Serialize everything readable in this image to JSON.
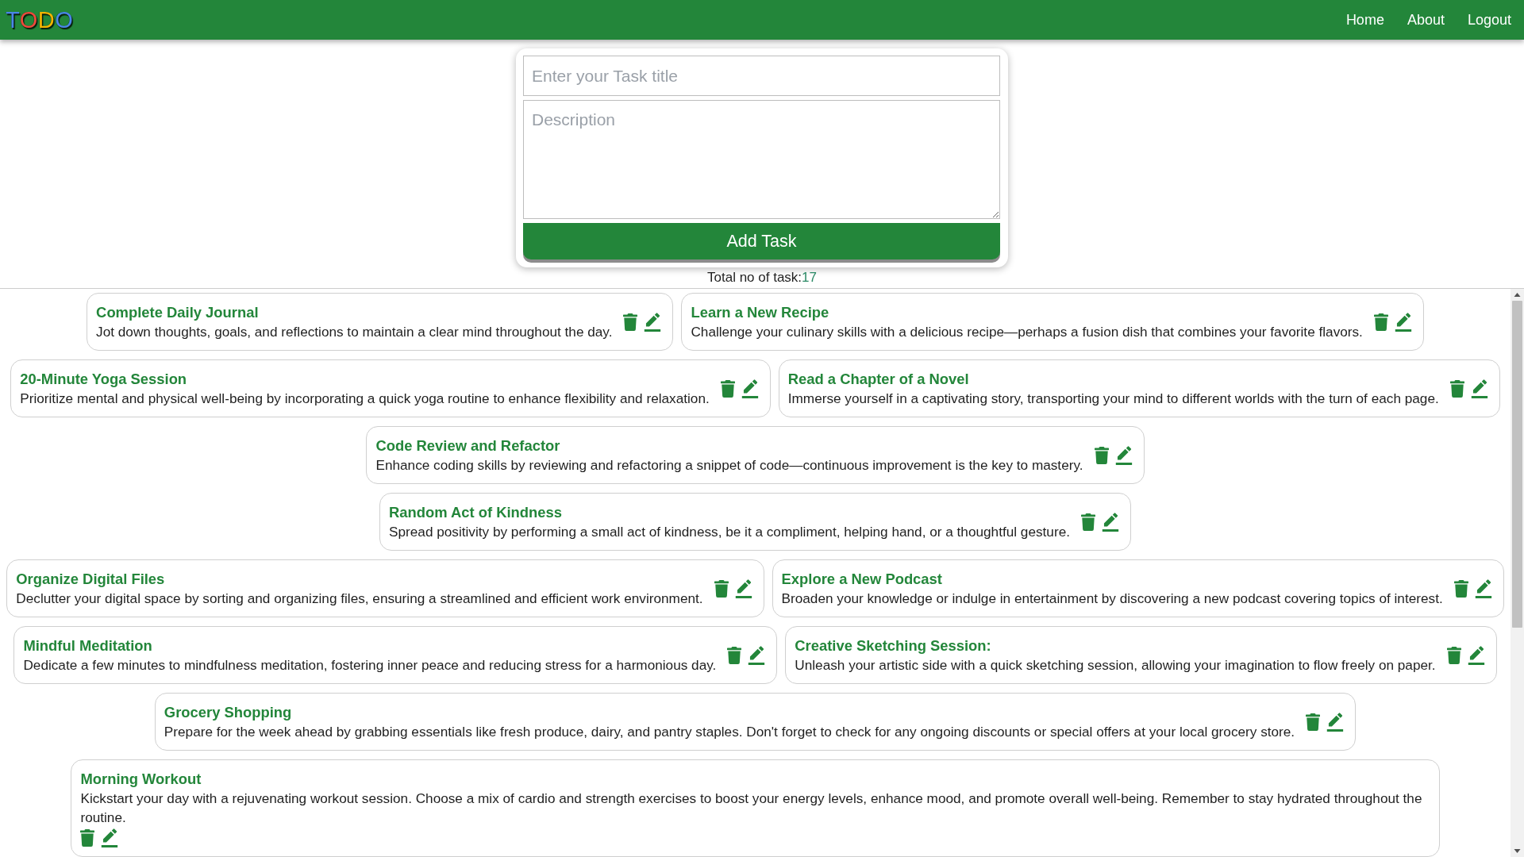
{
  "header": {
    "logo": [
      {
        "text": "T",
        "color": "#4a86e8"
      },
      {
        "text": "O",
        "color": "#ef4a3c"
      },
      {
        "text": "D",
        "color": "#f4b400"
      },
      {
        "text": "O",
        "color": "#4a86e8"
      }
    ],
    "nav": [
      "Home",
      "About",
      "Logout"
    ]
  },
  "form": {
    "title_field": {
      "placeholder": "Enter your Task title"
    },
    "description_field": {
      "placeholder": "Description"
    },
    "submit_button": "Add Task"
  },
  "total": {
    "label": "Total no of task:",
    "count": "17"
  },
  "tasks": [
    {
      "title": "Complete Daily Journal",
      "description": "Jot down thoughts, goals, and reflections to maintain a clear mind throughout the day."
    },
    {
      "title": "Learn a New Recipe",
      "description": "Challenge your culinary skills with a delicious recipe—perhaps a fusion dish that combines your favorite flavors."
    },
    {
      "title": "20-Minute Yoga Session",
      "description": "Prioritize mental and physical well-being by incorporating a quick yoga routine to enhance flexibility and relaxation."
    },
    {
      "title": "Read a Chapter of a Novel",
      "description": "Immerse yourself in a captivating story, transporting your mind to different worlds with the turn of each page."
    },
    {
      "title": "Code Review and Refactor",
      "description": "Enhance coding skills by reviewing and refactoring a snippet of code—continuous improvement is the key to mastery."
    },
    {
      "title": "Random Act of Kindness",
      "description": "Spread positivity by performing a small act of kindness, be it a compliment, helping hand, or a thoughtful gesture."
    },
    {
      "title": "Organize Digital Files",
      "description": "Declutter your digital space by sorting and organizing files, ensuring a streamlined and efficient work environment."
    },
    {
      "title": "Explore a New Podcast",
      "description": "Broaden your knowledge or indulge in entertainment by discovering a new podcast covering topics of interest."
    },
    {
      "title": "Mindful Meditation",
      "description": "Dedicate a few minutes to mindfulness meditation, fostering inner peace and reducing stress for a harmonious day."
    },
    {
      "title": "Creative Sketching Session:",
      "description": "Unleash your artistic side with a quick sketching session, allowing your imagination to flow freely on paper."
    },
    {
      "title": "Grocery Shopping",
      "description": "Prepare for the week ahead by grabbing essentials like fresh produce, dairy, and pantry staples. Don't forget to check for any ongoing discounts or special offers at your local grocery store."
    },
    {
      "title": "Morning Workout",
      "description": "Kickstart your day with a rejuvenating workout session. Choose a mix of cardio and strength exercises to boost your energy levels, enhance mood, and promote overall well-being. Remember to stay hydrated throughout the routine."
    }
  ]
}
